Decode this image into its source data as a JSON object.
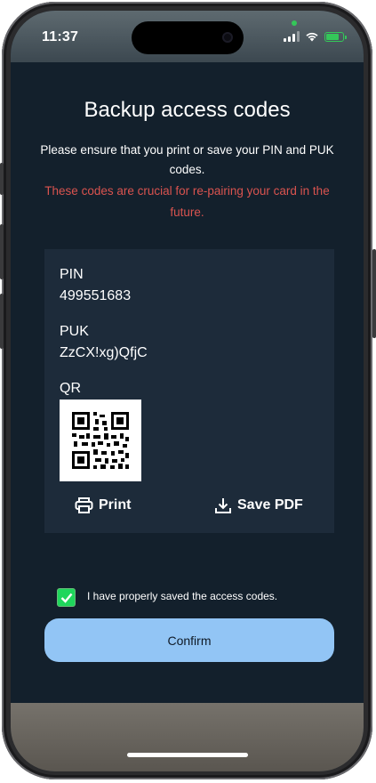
{
  "status_bar": {
    "time": "11:37"
  },
  "screen": {
    "title": "Backup access codes",
    "instruction": "Please ensure that you print or save your PIN and PUK codes.",
    "warning": "These codes are crucial for re-pairing your card in the future."
  },
  "codes": {
    "pin_label": "PIN",
    "pin_value": "499551683",
    "puk_label": "PUK",
    "puk_value": "ZzCX!xg)QfjC",
    "qr_label": "QR"
  },
  "actions": {
    "print_label": "Print",
    "save_pdf_label": "Save PDF"
  },
  "confirmation": {
    "checkbox_label": "I have properly saved the access codes.",
    "checked": true,
    "confirm_label": "Confirm"
  },
  "colors": {
    "background": "#13202c",
    "card": "#1d2b3a",
    "warning": "#d9534f",
    "button": "#92c5f5",
    "checkbox": "#1fd65c"
  },
  "icons": [
    "printer-icon",
    "download-icon",
    "checkmark-icon",
    "signal-icon",
    "wifi-icon",
    "battery-icon"
  ]
}
